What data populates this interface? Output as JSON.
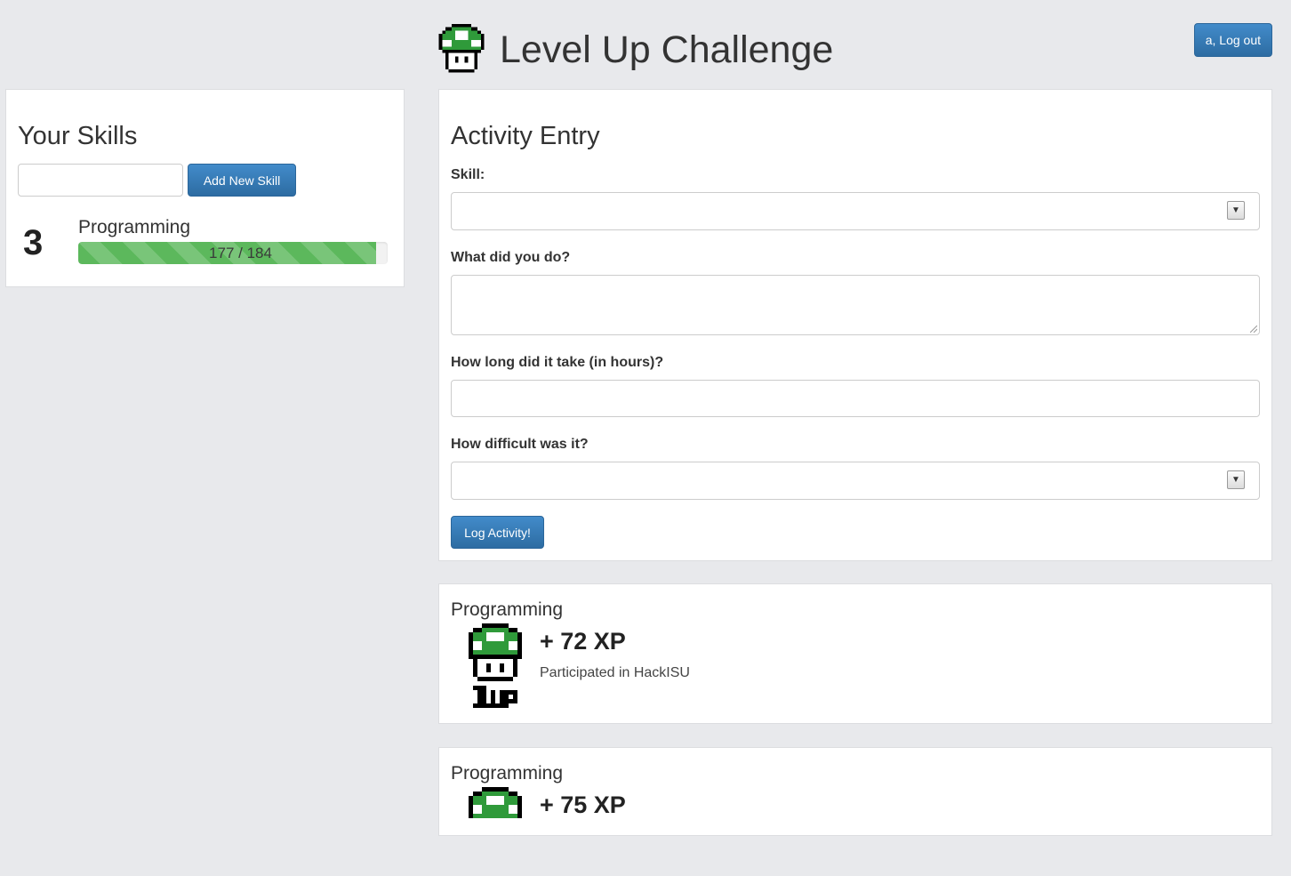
{
  "header": {
    "title": "Level Up Challenge",
    "logo_icon": "1up-mushroom-icon",
    "logout_label": "a, Log out"
  },
  "skills_panel": {
    "heading": "Your Skills",
    "new_skill_input": {
      "value": "",
      "placeholder": ""
    },
    "add_button_label": "Add New Skill",
    "skills": [
      {
        "level": "3",
        "name": "Programming",
        "progress_text": "177 / 184",
        "xp": 177,
        "xp_max": 184
      }
    ]
  },
  "activity_entry": {
    "heading": "Activity Entry",
    "skill_label": "Skill:",
    "skill_value": "",
    "what_label": "What did you do?",
    "what_value": "",
    "hours_label": "How long did it take (in hours)?",
    "hours_value": "",
    "difficulty_label": "How difficult was it?",
    "difficulty_value": "",
    "submit_label": "Log Activity!"
  },
  "activities": [
    {
      "skill": "Programming",
      "xp": "+ 72 XP",
      "description": "Participated in HackISU",
      "icon": "1up-mushroom-icon"
    },
    {
      "skill": "Programming",
      "xp": "+ 75 XP",
      "description": "",
      "icon": "1up-mushroom-icon"
    }
  ],
  "colors": {
    "background": "#e8e9ec",
    "primary": "#428bca",
    "progress": "#5cb85c",
    "mushroom_green": "#2f9a3a"
  }
}
